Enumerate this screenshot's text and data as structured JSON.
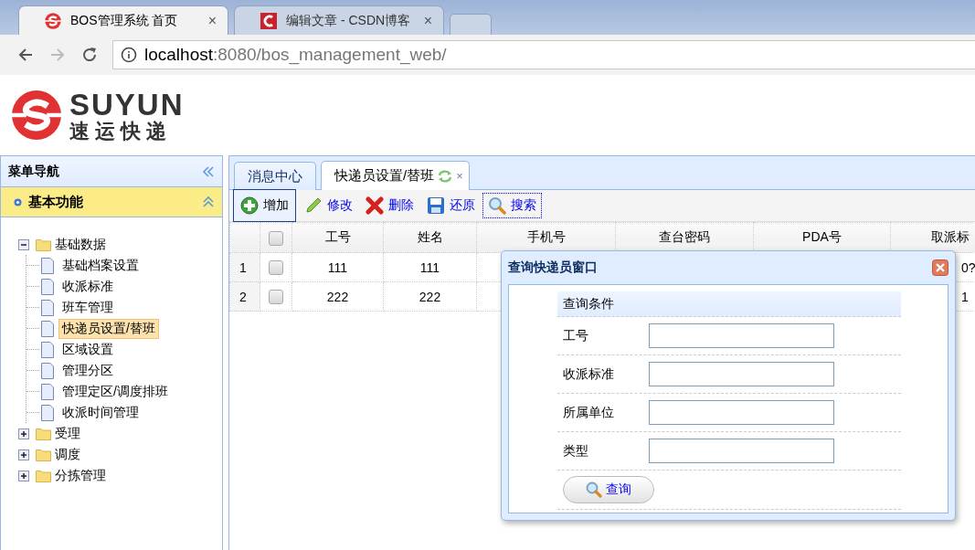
{
  "browser": {
    "tabs": [
      {
        "title": "BOS管理系统 首页",
        "selected": true,
        "close": "×"
      },
      {
        "title": "编辑文章 - CSDN博客",
        "selected": false,
        "close": "×"
      }
    ],
    "url": {
      "host": "localhost",
      "rest": ":8080/bos_management_web/"
    }
  },
  "logo": {
    "name": "SUYUN",
    "tagline": "速运快递"
  },
  "sidebar": {
    "title": "菜单导航",
    "section": "基本功能",
    "tree": [
      {
        "label": "基础数据",
        "expanded": true,
        "children": [
          {
            "label": "基础档案设置",
            "selected": false
          },
          {
            "label": "收派标准",
            "selected": false
          },
          {
            "label": "班车管理",
            "selected": false
          },
          {
            "label": "快递员设置/替班",
            "selected": true
          },
          {
            "label": "区域设置",
            "selected": false
          },
          {
            "label": "管理分区",
            "selected": false
          },
          {
            "label": "管理定区/调度排班",
            "selected": false
          },
          {
            "label": "收派时间管理",
            "selected": false
          }
        ]
      },
      {
        "label": "受理",
        "expanded": false
      },
      {
        "label": "调度",
        "expanded": false
      },
      {
        "label": "分拣管理",
        "expanded": false
      }
    ]
  },
  "content": {
    "tabs": [
      {
        "label": "消息中心",
        "selected": false
      },
      {
        "label": "快递员设置/替班",
        "selected": true,
        "close": "×"
      }
    ],
    "toolbar": [
      {
        "kind": "add",
        "label": "增加",
        "hovered": true,
        "focused": false
      },
      {
        "kind": "edit",
        "label": "修改",
        "hovered": false,
        "focused": false
      },
      {
        "kind": "delete",
        "label": "删除",
        "hovered": false,
        "focused": false
      },
      {
        "kind": "restore",
        "label": "还原",
        "hovered": false,
        "focused": false
      },
      {
        "kind": "search",
        "label": "搜索",
        "hovered": false,
        "focused": true
      }
    ],
    "grid": {
      "header_checked": false,
      "columns": [
        "工号",
        "姓名",
        "手机号",
        "查台密码",
        "PDA号",
        "取派标"
      ],
      "rows": [
        {
          "number": "1",
          "checked": false,
          "job_no": "111",
          "name": "111",
          "column_6": "0?"
        },
        {
          "number": "2",
          "checked": false,
          "job_no": "222",
          "name": "222",
          "column_6": "1"
        }
      ]
    }
  },
  "dialog": {
    "title": "查询快递员窗口",
    "section": "查询条件",
    "fields": [
      {
        "label": "工号"
      },
      {
        "label": "收派标准"
      },
      {
        "label": "所属单位"
      },
      {
        "label": "类型"
      }
    ],
    "button": "查询"
  }
}
